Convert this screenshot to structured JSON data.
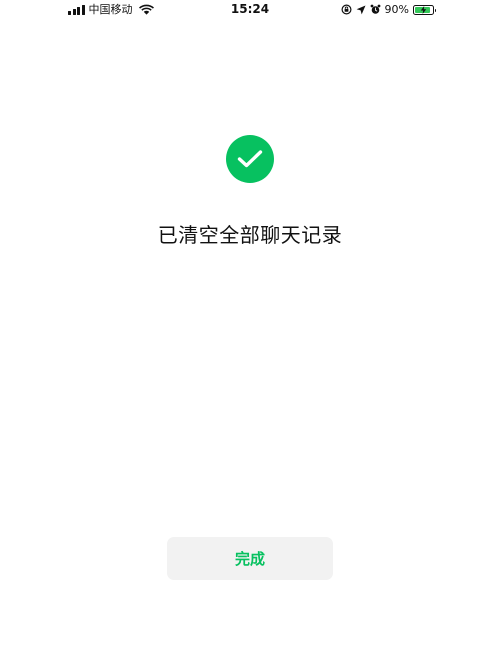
{
  "status_bar": {
    "carrier": "中国移动",
    "time": "15:24",
    "battery": "90%",
    "battery_level": 0.9
  },
  "main": {
    "title": "已清空全部聊天记录",
    "done_label": "完成"
  },
  "colors": {
    "accent": "#07c160",
    "button_bg": "#f2f2f2",
    "battery_fill": "#34c759"
  },
  "icons": [
    "signal-icon",
    "wifi-icon",
    "orientation-lock-icon",
    "location-icon",
    "alarm-icon",
    "battery-icon",
    "check-icon"
  ]
}
